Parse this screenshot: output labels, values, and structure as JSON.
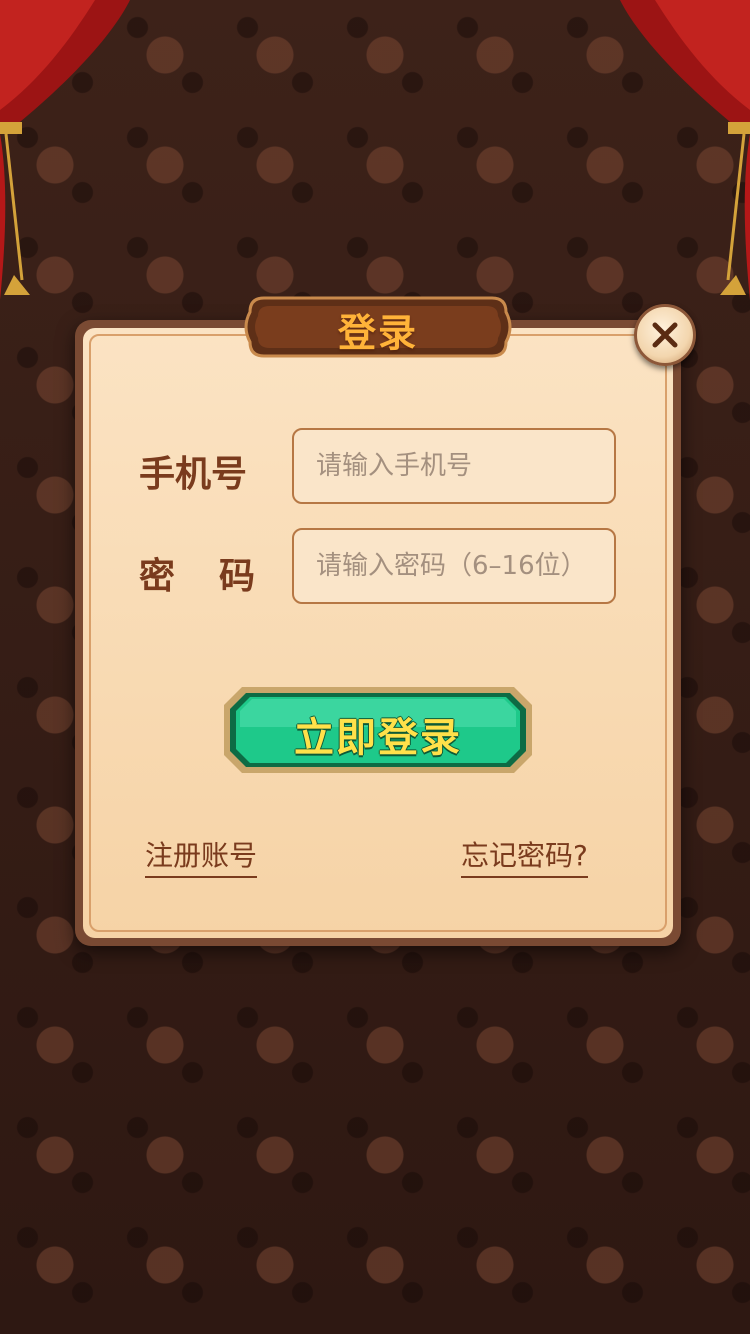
{
  "dialog": {
    "title": "登录",
    "close_icon": "close-icon"
  },
  "form": {
    "phone": {
      "label": "手机号",
      "placeholder": "请输入手机号",
      "value": ""
    },
    "password": {
      "label_first": "密",
      "label_second": "码",
      "placeholder": "请输入密码（6–16位）",
      "value": ""
    },
    "submit_label": "立即登录"
  },
  "links": {
    "register": "注册账号",
    "forgot": "忘记密码?"
  },
  "colors": {
    "background": "#3a2018",
    "panel": "#f6d3a6",
    "panel_border": "#7a4a33",
    "label_text": "#7a3b1d",
    "title_text": "#ffb339",
    "button_green": "#1ec98a",
    "button_text": "#ffe14a"
  }
}
